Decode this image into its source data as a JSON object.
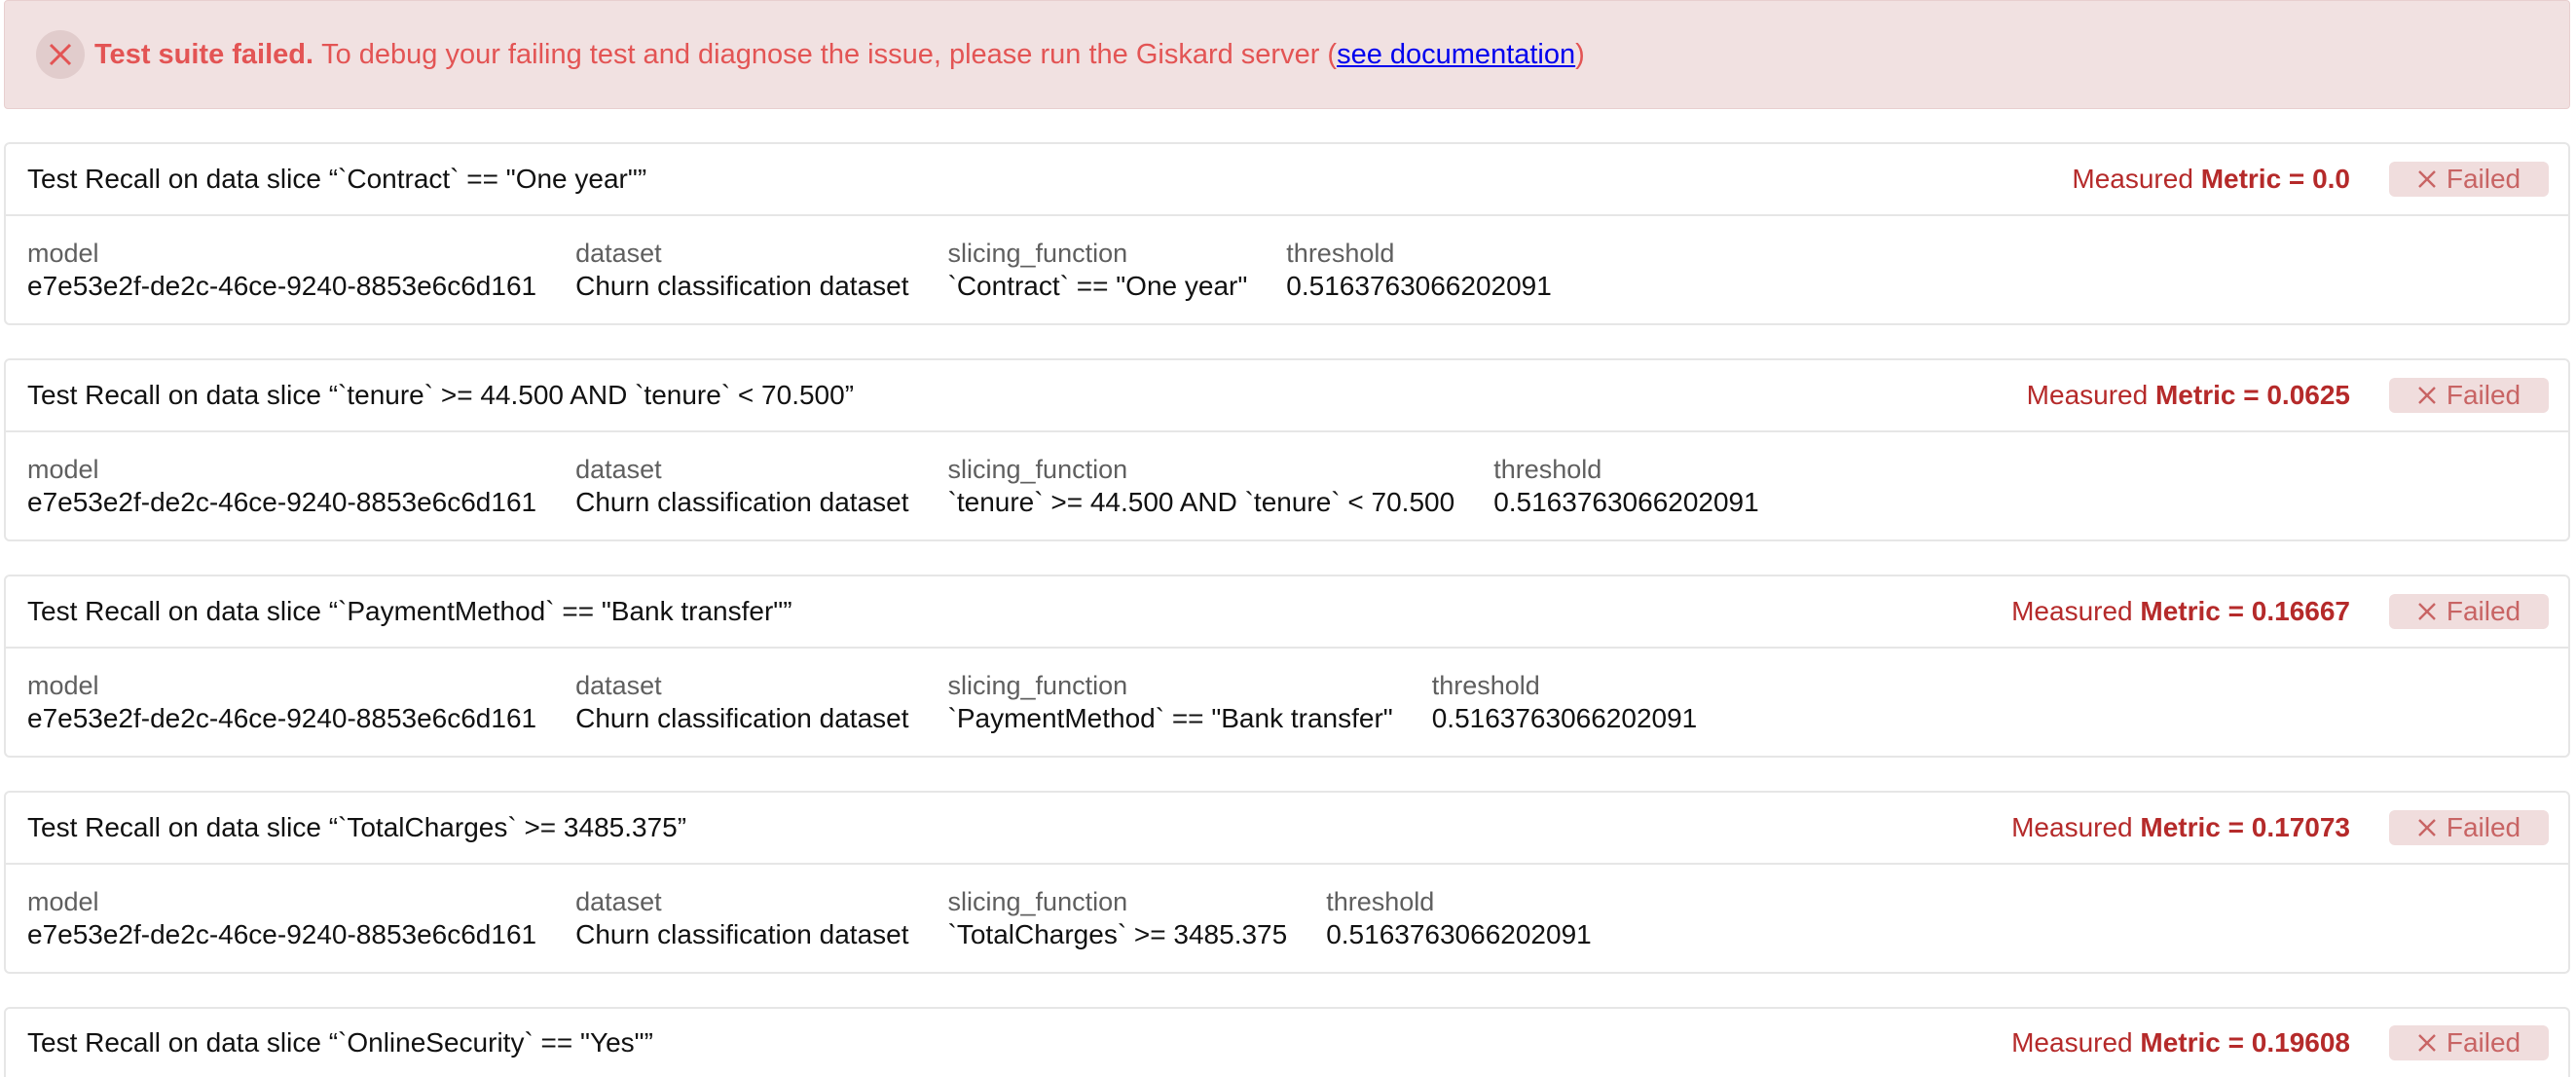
{
  "banner": {
    "title": "Test suite failed.",
    "message": "To debug your failing test and diagnose the issue, please run the Giskard server (",
    "link": "see documentation",
    "message_end": ")",
    "icon": "close-circle-icon",
    "color": "#e35454"
  },
  "labels": {
    "model": "model",
    "dataset": "dataset",
    "slicing_function": "slicing_function",
    "threshold": "threshold",
    "measured": "Measured",
    "failed": "Failed"
  },
  "tests": [
    {
      "title": "Test Recall on data slice “`Contract` == \"One year\"”",
      "metric": "Metric = 0.0",
      "model": "e7e53e2f-de2c-46ce-9240-8853e6c6d161",
      "dataset": "Churn classification dataset",
      "slicing_function": "`Contract` == \"One year\"",
      "threshold": "0.5163763066202091"
    },
    {
      "title": "Test Recall on data slice “`tenure` >= 44.500 AND `tenure` < 70.500”",
      "metric": "Metric = 0.0625",
      "model": "e7e53e2f-de2c-46ce-9240-8853e6c6d161",
      "dataset": "Churn classification dataset",
      "slicing_function": "`tenure` >= 44.500 AND `tenure` < 70.500",
      "threshold": "0.5163763066202091"
    },
    {
      "title": "Test Recall on data slice “`PaymentMethod` == \"Bank transfer\"”",
      "metric": "Metric = 0.16667",
      "model": "e7e53e2f-de2c-46ce-9240-8853e6c6d161",
      "dataset": "Churn classification dataset",
      "slicing_function": "`PaymentMethod` == \"Bank transfer\"",
      "threshold": "0.5163763066202091"
    },
    {
      "title": "Test Recall on data slice “`TotalCharges` >= 3485.375”",
      "metric": "Metric = 0.17073",
      "model": "e7e53e2f-de2c-46ce-9240-8853e6c6d161",
      "dataset": "Churn classification dataset",
      "slicing_function": "`TotalCharges` >= 3485.375",
      "threshold": "0.5163763066202091"
    },
    {
      "title": "Test Recall on data slice “`OnlineSecurity` == \"Yes\"”",
      "metric": "Metric = 0.19608"
    }
  ],
  "colors": {
    "metric": "#b52a2a",
    "badge_bg": "#f0dddd",
    "badge_text": "#c86464",
    "banner_bg": "#f1e1e1"
  }
}
